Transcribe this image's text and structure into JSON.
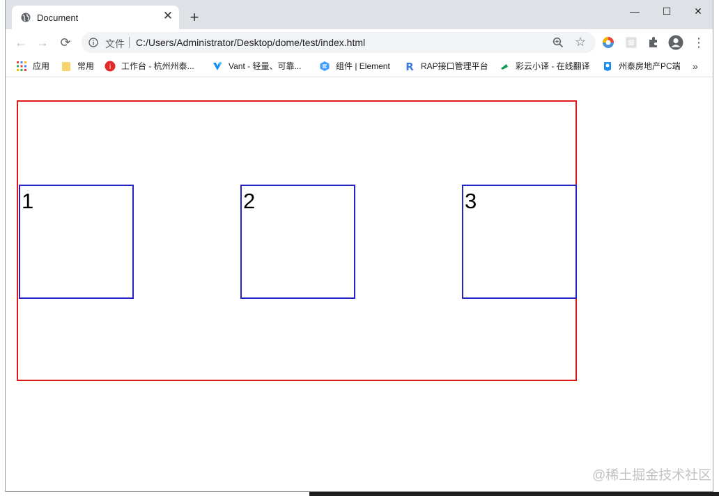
{
  "tab": {
    "title": "Document",
    "close_label": "✕"
  },
  "newtab_label": "+",
  "window_controls": {
    "minimize": "—",
    "maximize": "☐",
    "close": "✕"
  },
  "toolbar": {
    "back": "←",
    "forward": "→",
    "reload": "⟳",
    "protocol_label": "文件",
    "url": "C:/Users/Administrator/Desktop/dome/test/index.html",
    "star": "☆",
    "menu": "⋮"
  },
  "bookmarks": [
    {
      "label": "应用",
      "icon": "apps-grid-icon"
    },
    {
      "label": "常用",
      "icon": "folder-icon"
    },
    {
      "label": "工作台 - 杭州州泰...",
      "icon": "workbench-icon"
    },
    {
      "label": "Vant - 轻量、可靠...",
      "icon": "vant-icon"
    },
    {
      "label": "组件 | Element",
      "icon": "element-icon"
    },
    {
      "label": "RAP接口管理平台",
      "icon": "rap-icon"
    },
    {
      "label": "彩云小译 - 在线翻译",
      "icon": "caiyun-icon"
    },
    {
      "label": "州泰房地产PC端",
      "icon": "realestate-icon"
    }
  ],
  "bookmarks_more": "»",
  "page": {
    "boxes": [
      "1",
      "2",
      "3"
    ],
    "outer_border_color": "#e11919",
    "box_border_color": "#2323c8"
  },
  "watermark": "@稀土掘金技术社区"
}
